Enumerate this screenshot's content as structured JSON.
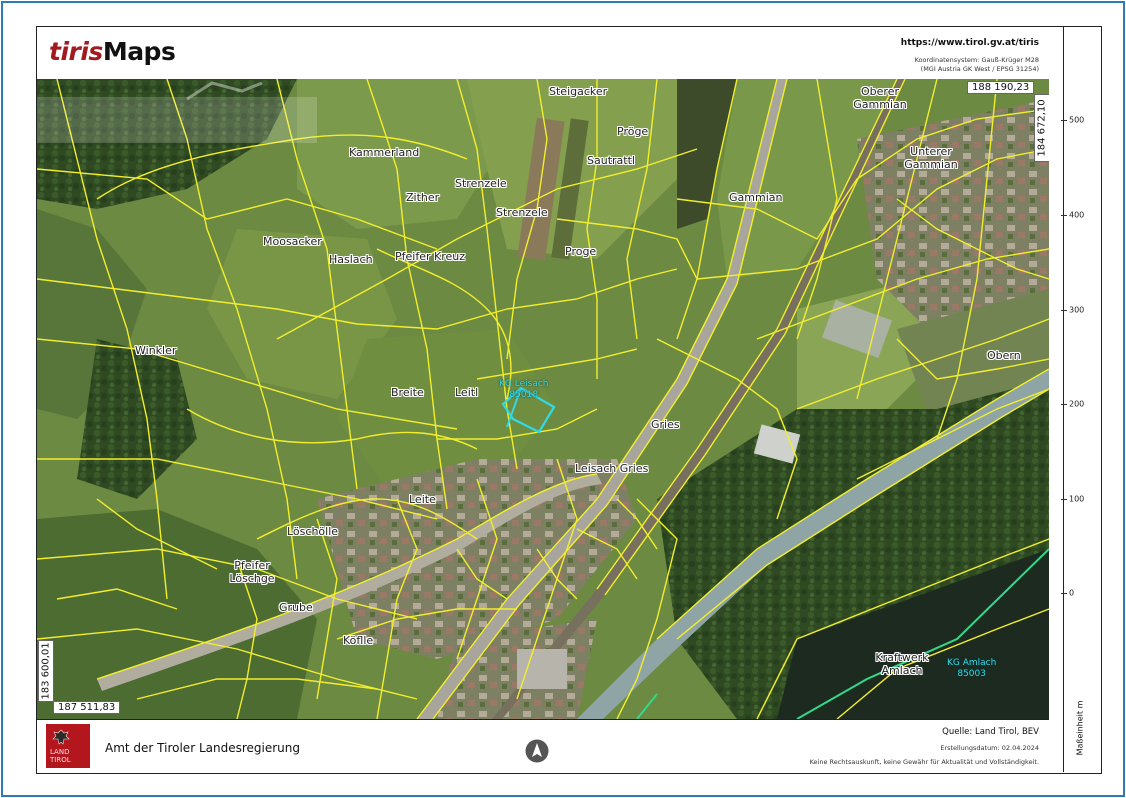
{
  "header": {
    "logo_tiris": "tiris",
    "logo_maps": "Maps",
    "url": "https://www.tirol.gv.at/tiris",
    "crs_line1": "Koordinatensystem: Gauß-Krüger M28",
    "crs_line2": "(MGI Austria GK West / EPSG 31254)"
  },
  "map": {
    "coord_top_right": "188 190,23",
    "coord_right_vertical": "184 672,10",
    "coord_bottom_left": "187 511,83",
    "coord_left_vertical": "183 600,01",
    "place_names": [
      "Steigacker",
      "Oberer Gammian",
      "Pröge",
      "Kammerland",
      "Sautrattl",
      "Unterer Gammian",
      "Strenzele",
      "Zither",
      "Strenzele",
      "Gammian",
      "Moosacker",
      "Haslach",
      "Pfeifer Kreuz",
      "Proge",
      "Winkler",
      "Obern",
      "Breite",
      "Leitl",
      "Gries",
      "Leisach Gries",
      "Leite",
      "Löschölle",
      "Pfeifer Löschge",
      "Grube",
      "Köflle",
      "Kraftwerk Amlach"
    ],
    "kg_labels": [
      {
        "line1": "KG Leisach",
        "line2": "85018"
      },
      {
        "line1": "KG Amlach",
        "line2": "85003"
      }
    ],
    "colors": {
      "parcel_lines": "#f2ee2e",
      "cadastral_highlight": "#31d8e6",
      "boundary_green": "#33d98a"
    }
  },
  "scale": {
    "ticks": [
      "500",
      "400",
      "300",
      "200",
      "100",
      "0"
    ],
    "unit_label": "Maßeinheit m"
  },
  "footer": {
    "emblem_text_line1": "LAND",
    "emblem_text_line2": "TIROL",
    "authority": "Amt der Tiroler Landesregierung",
    "source": "Quelle: Land Tirol, BEV",
    "date": "Erstellungsdatum:  02.04.2024",
    "disclaimer": "Keine Rechtsauskunft, keine Gewähr für Aktualität und Vollständigkeit."
  }
}
